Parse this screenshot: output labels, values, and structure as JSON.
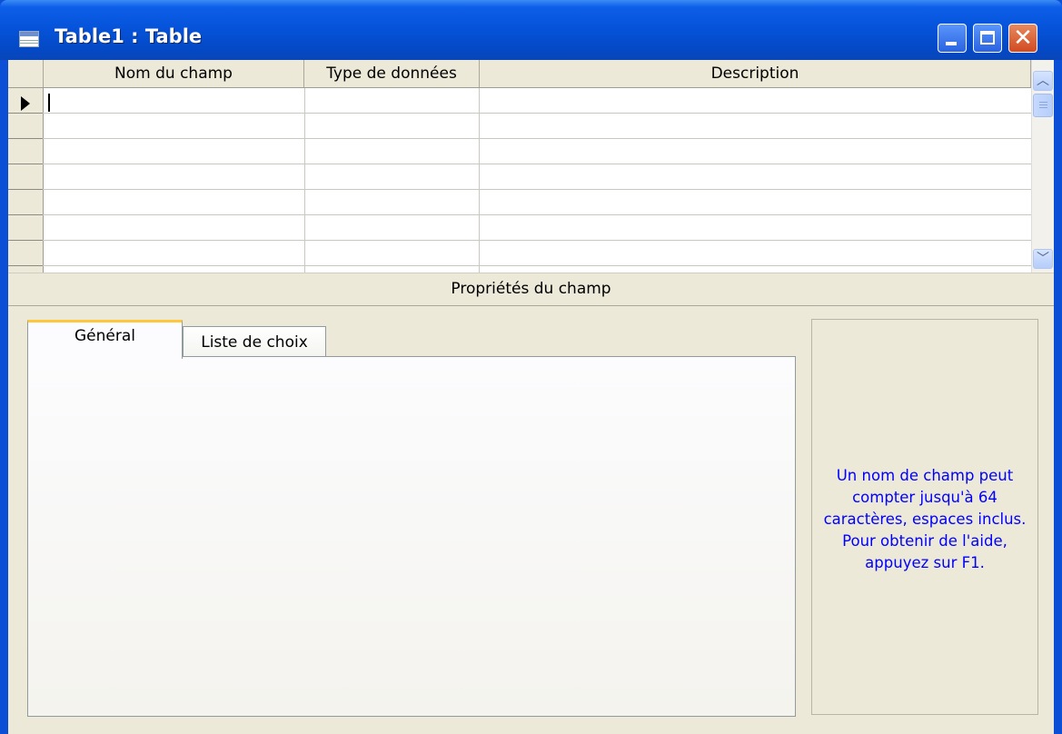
{
  "window": {
    "title": "Table1 : Table",
    "close_glyph": "✕"
  },
  "grid": {
    "columns": [
      "Nom du champ",
      "Type de données",
      "Description"
    ],
    "current_row_indicator": "triangle-arrow"
  },
  "properties": {
    "header": "Propriétés du champ",
    "tabs": [
      {
        "label": "Général",
        "selected": true
      },
      {
        "label": "Liste de choix",
        "selected": false
      }
    ],
    "help_text": "Un nom de champ peut compter jusqu'à 64 caractères, espaces inclus. Pour obtenir de l'aide, appuyez sur F1."
  },
  "scrollbar": {
    "up_glyph": "︿",
    "down_glyph": "﹀"
  },
  "colors": {
    "titlebar": "#0552d8",
    "help_text": "#0000ff",
    "active_tab_accent": "#ffc83c"
  }
}
